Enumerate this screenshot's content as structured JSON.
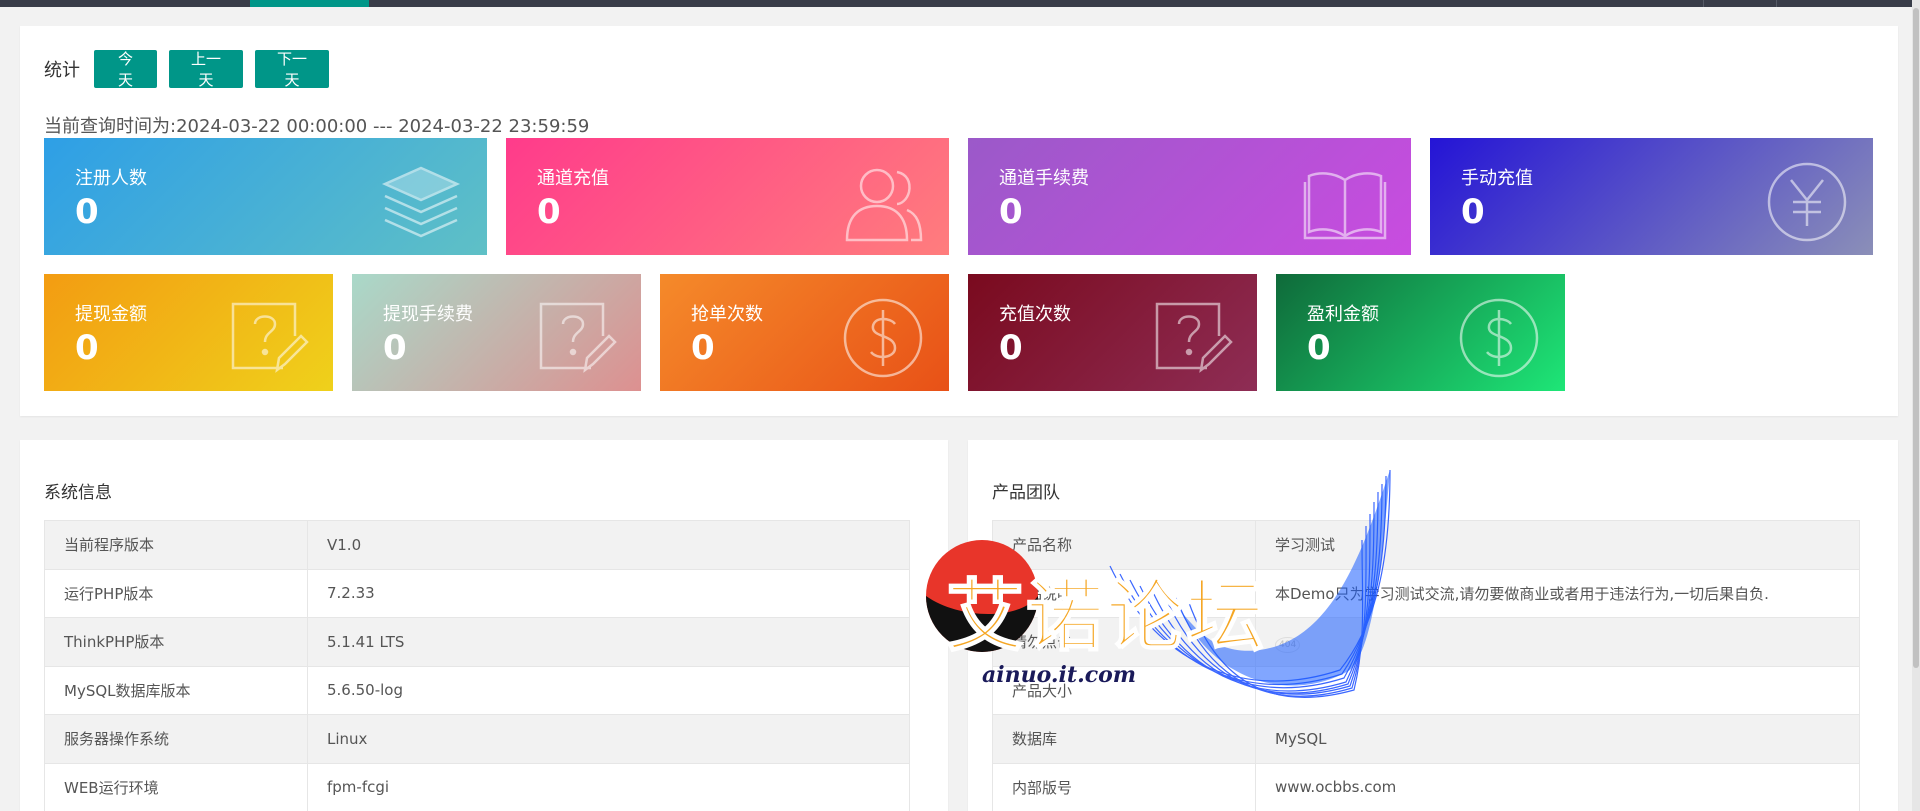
{
  "stats": {
    "title": "统计",
    "buttons": {
      "today": "今 天",
      "prev": "上一天",
      "next": "下一天"
    },
    "query_prefix": "当前查询时间为:",
    "start": "2024-03-22 00:00:00",
    "sep": " --- ",
    "end": "2024-03-22 23:59:59",
    "tiles": [
      {
        "label": "注册人数",
        "value": "0",
        "icon": "layers-icon"
      },
      {
        "label": "通道充值",
        "value": "0",
        "icon": "users-icon"
      },
      {
        "label": "通道手续费",
        "value": "0",
        "icon": "book-icon"
      },
      {
        "label": "手动充值",
        "value": "0",
        "icon": "yen-icon"
      },
      {
        "label": "提现金额",
        "value": "0",
        "icon": "question-note-icon"
      },
      {
        "label": "提现手续费",
        "value": "0",
        "icon": "question-note-icon"
      },
      {
        "label": "抢单次数",
        "value": "0",
        "icon": "dollar-icon"
      },
      {
        "label": "充值次数",
        "value": "0",
        "icon": "question-note-icon"
      },
      {
        "label": "盈利金额",
        "value": "0",
        "icon": "dollar-icon"
      }
    ]
  },
  "system": {
    "title": "系统信息",
    "rows": [
      {
        "k": "当前程序版本",
        "v": "V1.0"
      },
      {
        "k": "运行PHP版本",
        "v": "7.2.33"
      },
      {
        "k": "ThinkPHP版本",
        "v": "5.1.41 LTS"
      },
      {
        "k": "MySQL数据库版本",
        "v": "5.6.50-log"
      },
      {
        "k": "服务器操作系统",
        "v": "Linux"
      },
      {
        "k": "WEB运行环境",
        "v": "fpm-fcgi"
      }
    ]
  },
  "team": {
    "title": "产品团队",
    "rows": [
      {
        "k": "产品名称",
        "v": "学习测试"
      },
      {
        "k": "产品说明",
        "v": "本Demo只为学习测试交流,请勿要做商业或者用于违法行为,一切后果自负."
      },
      {
        "k": "请勿点击",
        "v": "404"
      },
      {
        "k": "产品大小",
        "v": ""
      },
      {
        "k": "数据库",
        "v": "MySQL"
      },
      {
        "k": "内部版号",
        "v": "www.ocbbs.com"
      }
    ]
  },
  "watermark": {
    "text": "艾诺论坛",
    "url": "ainuo.it.com"
  },
  "colors": {
    "accent": "#009688",
    "tile_gradients": [
      [
        "#2e9fe6",
        "#5fc0c6"
      ],
      [
        "#ff3b8b",
        "#ff7d7d"
      ],
      [
        "#9b59c9",
        "#c94ce0"
      ],
      [
        "#2414d6",
        "#8b8fb8"
      ],
      [
        "#f39c12",
        "#efd11b"
      ],
      [
        "#a9d9c9",
        "#dd9090"
      ],
      [
        "#f58a2a",
        "#e85117"
      ],
      [
        "#7a0a1e",
        "#8e2d55"
      ],
      [
        "#0f6a3a",
        "#1ee677"
      ]
    ]
  }
}
